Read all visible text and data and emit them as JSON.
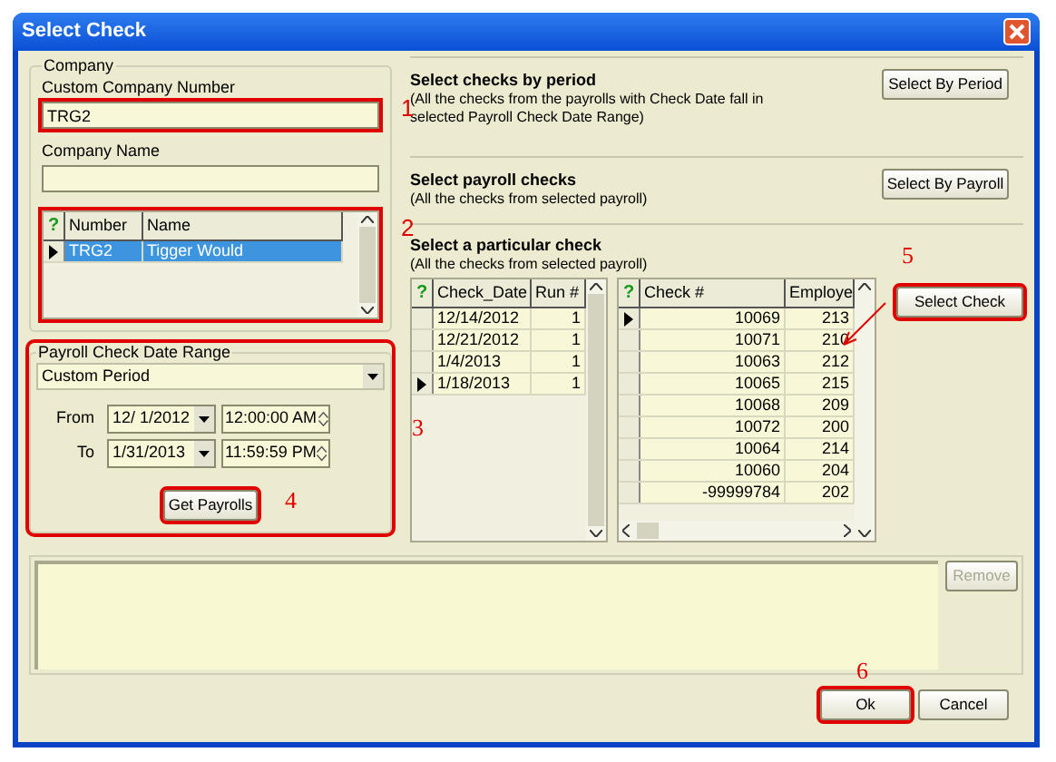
{
  "window": {
    "title": "Select Check"
  },
  "company": {
    "group_label": "Company",
    "number_label": "Custom Company Number",
    "number_value": "TRG2",
    "number_highlighted": true,
    "name_label": "Company Name"
  },
  "company_grid": {
    "highlighted": true,
    "corner": "?",
    "columns": [
      "Number",
      "Name"
    ],
    "rows": [
      {
        "cells": [
          "TRG2",
          "Tigger Would"
        ],
        "selected": true,
        "current": true
      }
    ]
  },
  "date_range": {
    "group_label": "Payroll Check Date Range",
    "highlighted": true,
    "period": "Custom Period",
    "from_label": "From",
    "from_date": "12/ 1/2012",
    "from_time": "12:00:00 AM",
    "to_label": "To",
    "to_date": "1/31/2013",
    "to_time": "11:59:59 PM",
    "button": {
      "label": "Get Payrolls",
      "highlighted": true
    }
  },
  "sections": [
    {
      "title": "Select checks by period",
      "description": "(All the checks from the payrolls with Check Date fall in selected Payroll Check Date Range)",
      "button": {
        "label": "Select By Period",
        "highlighted": false
      }
    },
    {
      "title": "Select payroll checks",
      "description": "(All the checks from selected payroll)",
      "button": {
        "label": "Select By Payroll",
        "highlighted": false
      }
    },
    {
      "title": "Select a particular check",
      "description": "(All the checks from selected payroll)",
      "button": {
        "label": "Select Check",
        "highlighted": true
      }
    }
  ],
  "payroll_grid": {
    "corner": "?",
    "columns": [
      "Check_Date",
      "Run #"
    ],
    "rows": [
      {
        "cells": [
          "12/14/2012",
          "1"
        ],
        "current": false
      },
      {
        "cells": [
          "12/21/2012",
          "1"
        ],
        "current": false
      },
      {
        "cells": [
          "1/4/2013",
          "1"
        ],
        "current": false
      },
      {
        "cells": [
          "1/18/2013",
          "1"
        ],
        "current": true
      }
    ]
  },
  "check_grid": {
    "corner": "?",
    "columns": [
      "Check #",
      "Employe"
    ],
    "rows": [
      {
        "cells": [
          "10069",
          "213"
        ],
        "current": true
      },
      {
        "cells": [
          "10071",
          "210"
        ],
        "current": false
      },
      {
        "cells": [
          "10063",
          "212"
        ],
        "current": false
      },
      {
        "cells": [
          "10065",
          "215"
        ],
        "current": false
      },
      {
        "cells": [
          "10068",
          "209"
        ],
        "current": false
      },
      {
        "cells": [
          "10072",
          "200"
        ],
        "current": false
      },
      {
        "cells": [
          "10064",
          "214"
        ],
        "current": false
      },
      {
        "cells": [
          "10060",
          "204"
        ],
        "current": false
      },
      {
        "cells": [
          "-99999784",
          "202"
        ],
        "current": false
      }
    ]
  },
  "remove_button": {
    "label": "Remove",
    "disabled": true
  },
  "footer_buttons": [
    {
      "label": "Ok",
      "highlighted": true
    },
    {
      "label": "Cancel",
      "highlighted": false
    }
  ],
  "callouts": [
    "1",
    "2",
    "3",
    "4",
    "5",
    "6"
  ]
}
